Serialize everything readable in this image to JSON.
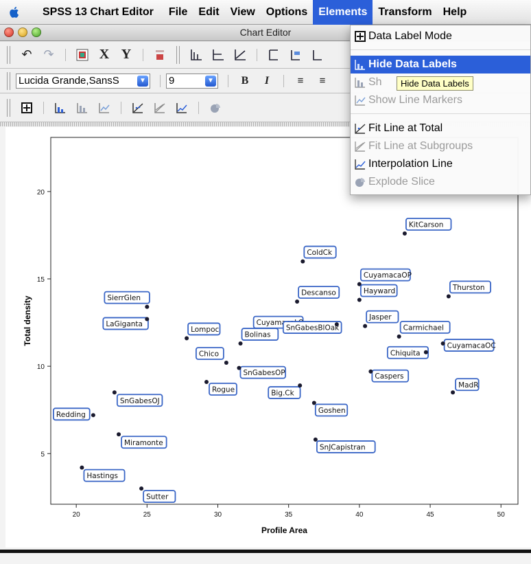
{
  "menubar": {
    "app": "SPSS 13 Chart Editor",
    "items": [
      "File",
      "Edit",
      "View",
      "Options",
      "Elements",
      "Transform",
      "Help"
    ]
  },
  "window": {
    "title": "Chart Editor"
  },
  "format_toolbar": {
    "font": "Lucida Grande,SansS",
    "size": "9"
  },
  "elements_menu": {
    "items": [
      {
        "label": "Data Label Mode",
        "enabled": true,
        "icon": "data-label-mode-icon"
      },
      {
        "label": "Hide Data Labels",
        "enabled": true,
        "highlighted": true,
        "icon": "bar-labels-icon"
      },
      {
        "label": "Show Line Markers",
        "enabled": false,
        "icon": "line-markers-icon"
      },
      {
        "label": "Fit Line at Total",
        "enabled": true,
        "icon": "fit-line-icon"
      },
      {
        "label": "Fit Line at Subgroups",
        "enabled": false,
        "icon": "fit-subgroups-icon"
      },
      {
        "label": "Interpolation Line",
        "enabled": true,
        "icon": "interpolation-icon"
      },
      {
        "label": "Explode Slice",
        "enabled": false,
        "icon": "explode-slice-icon"
      }
    ],
    "partial_label": "Sh",
    "tooltip": "Hide Data Labels"
  },
  "colors": {
    "accent": "#2b5fd9",
    "label_border": "#3a66c6",
    "point": "#1a1a2e"
  },
  "chart_data": {
    "type": "scatter",
    "xlabel": "Profile Area",
    "ylabel": "Total density",
    "xlim": [
      18.2,
      51.2
    ],
    "ylim": [
      2.1,
      23.1
    ],
    "xticks": [
      20,
      25,
      30,
      35,
      40,
      45,
      50
    ],
    "yticks": [
      5,
      10,
      15,
      20
    ],
    "points": [
      {
        "name": "Redding",
        "x": 21.2,
        "y": 7.2
      },
      {
        "name": "Hastings",
        "x": 20.4,
        "y": 4.2
      },
      {
        "name": "SnGabesOJ",
        "x": 22.7,
        "y": 8.5
      },
      {
        "name": "Miramonte",
        "x": 23.0,
        "y": 6.1
      },
      {
        "name": "Sutter",
        "x": 24.6,
        "y": 3.0
      },
      {
        "name": "SierrGlen",
        "x": 25.0,
        "y": 13.4
      },
      {
        "name": "LaGiganta",
        "x": 25.0,
        "y": 12.7
      },
      {
        "name": "Lompoc",
        "x": 27.8,
        "y": 11.6
      },
      {
        "name": "Chico",
        "x": 30.6,
        "y": 10.2
      },
      {
        "name": "Rogue",
        "x": 29.2,
        "y": 9.1
      },
      {
        "name": "Bolinas",
        "x": 31.6,
        "y": 11.3
      },
      {
        "name": "SnGabesOP",
        "x": 31.5,
        "y": 9.9
      },
      {
        "name": "Big.Ck",
        "x": 35.8,
        "y": 8.9
      },
      {
        "name": "Goshen",
        "x": 36.8,
        "y": 7.9
      },
      {
        "name": "SnJCapistran",
        "x": 36.9,
        "y": 5.8
      },
      {
        "name": "ColdCk",
        "x": 36.0,
        "y": 16.0
      },
      {
        "name": "Descanso",
        "x": 35.6,
        "y": 13.7
      },
      {
        "name": "CuyamacaLO",
        "x": 36.5,
        "y": 12.3
      },
      {
        "name": "SnGabesBlOak",
        "x": 38.4,
        "y": 12.4
      },
      {
        "name": "CuyamacaOP",
        "x": 40.0,
        "y": 14.7
      },
      {
        "name": "Hayward",
        "x": 40.0,
        "y": 13.8
      },
      {
        "name": "Jasper",
        "x": 40.4,
        "y": 12.3
      },
      {
        "name": "Caspers",
        "x": 40.8,
        "y": 9.7
      },
      {
        "name": "Chiquita",
        "x": 44.7,
        "y": 10.8
      },
      {
        "name": "Carmichael",
        "x": 42.8,
        "y": 11.7
      },
      {
        "name": "KitCarson",
        "x": 43.2,
        "y": 17.6
      },
      {
        "name": "Thurston",
        "x": 46.3,
        "y": 14.0
      },
      {
        "name": "CuyamacaOC",
        "x": 45.9,
        "y": 11.3
      },
      {
        "name": "MadR",
        "x": 46.6,
        "y": 8.5
      }
    ]
  }
}
